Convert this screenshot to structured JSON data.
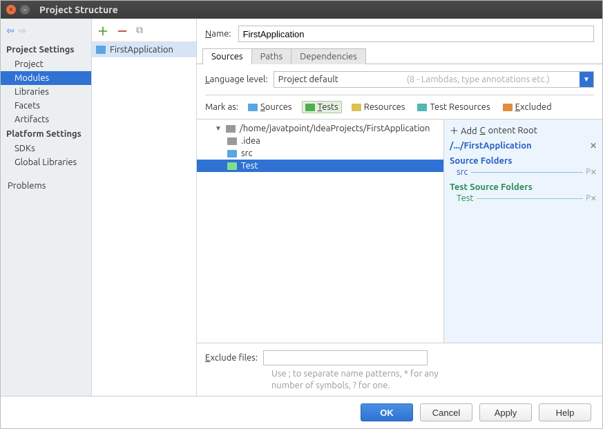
{
  "window": {
    "title": "Project Structure"
  },
  "sidebar": {
    "sections": [
      {
        "heading": "Project Settings",
        "items": [
          "Project",
          "Modules",
          "Libraries",
          "Facets",
          "Artifacts"
        ],
        "selected": 1
      },
      {
        "heading": "Platform Settings",
        "items": [
          "SDKs",
          "Global Libraries"
        ]
      }
    ],
    "problems_label": "Problems"
  },
  "modules": {
    "items": [
      "FirstApplication"
    ],
    "selected": 0
  },
  "detail": {
    "name_label": "Name:",
    "name_value": "FirstApplication",
    "tabs": [
      "Sources",
      "Paths",
      "Dependencies"
    ],
    "active_tab": 0,
    "language_level_label": "Language level:",
    "language_level_value": "Project default",
    "language_level_hint": "(8 - Lambdas, type annotations etc.)",
    "mark_as_label": "Mark as:",
    "mark_buttons": [
      "Sources",
      "Tests",
      "Resources",
      "Test Resources",
      "Excluded"
    ],
    "mark_selected": 1,
    "tree": {
      "root": "/home/javatpoint/IdeaProjects/FirstApplication",
      "children": [
        {
          "name": ".idea",
          "type": "folder"
        },
        {
          "name": "src",
          "type": "source"
        },
        {
          "name": "Test",
          "type": "test",
          "selected": true
        }
      ]
    },
    "content_root": {
      "add_label": "Add Content Root",
      "root_path": "/.../FirstApplication",
      "groups": [
        {
          "title": "Source Folders",
          "color": "blue",
          "items": [
            "src"
          ]
        },
        {
          "title": "Test Source Folders",
          "color": "green",
          "items": [
            "Test"
          ]
        }
      ]
    },
    "exclude_label": "Exclude files:",
    "exclude_value": "",
    "exclude_hint": "Use ; to separate name patterns, * for any number of symbols, ? for one."
  },
  "buttons": {
    "ok": "OK",
    "cancel": "Cancel",
    "apply": "Apply",
    "help": "Help"
  }
}
